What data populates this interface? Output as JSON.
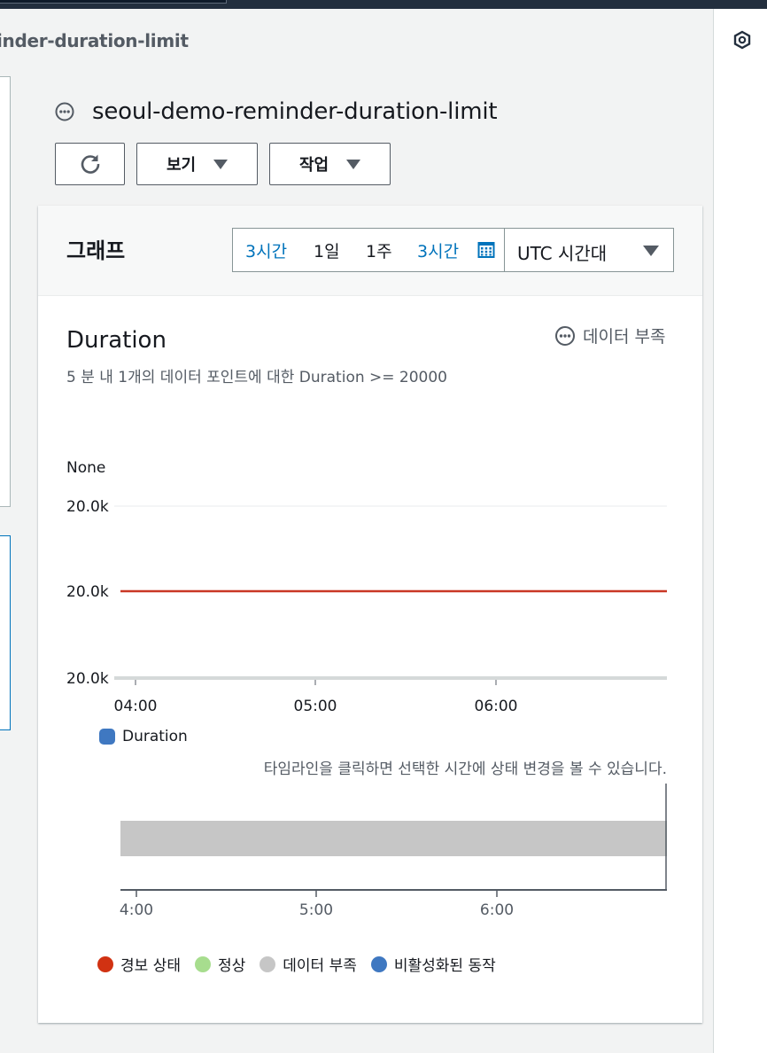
{
  "breadcrumb": {
    "text": "inder-duration-limit"
  },
  "page": {
    "title": "seoul-demo-reminder-duration-limit"
  },
  "toolbar": {
    "view_label": "보기",
    "action_label": "작업"
  },
  "graph_panel": {
    "title": "그래프",
    "ranges": [
      "3시간",
      "1일",
      "1주"
    ],
    "custom_range": "3시간",
    "timezone": "UTC 시간대"
  },
  "metric": {
    "title": "Duration",
    "condition": "5 분 내 1개의 데이터 포인트에 대한 Duration >= 20000",
    "state_label": "데이터 부족",
    "y_unit_label": "None",
    "legend": "Duration",
    "timeline_hint": "타임라인을 클릭하면 선택한 시간에 상태 변경을 볼 수 있습니다.",
    "state_legend": [
      "경보 상태",
      "정상",
      "데이터 부족",
      "비활성화된 동작"
    ]
  },
  "colors": {
    "alarm": "#d13212",
    "ok": "#a7dd8e",
    "insufficient": "#c6c6c6",
    "disabled": "#3f78c1",
    "series": "#3f78c1",
    "threshold": "#c93725"
  },
  "chart_data": [
    {
      "type": "line",
      "title": "Duration",
      "ylabel": "None",
      "y_tick_labels": [
        "20.0k",
        "20.0k",
        "20.0k"
      ],
      "x_tick_labels": [
        "04:00",
        "05:00",
        "06:00"
      ],
      "threshold": 20000,
      "series": [
        {
          "name": "Duration",
          "values": []
        }
      ],
      "legend": "bottom-left",
      "grid": true
    },
    {
      "type": "bar",
      "title": "",
      "x_tick_labels": [
        "4:00",
        "5:00",
        "6:00"
      ],
      "series": [
        {
          "name": "데이터 부족",
          "values": [
            1
          ]
        }
      ],
      "legend": "bottom"
    }
  ]
}
